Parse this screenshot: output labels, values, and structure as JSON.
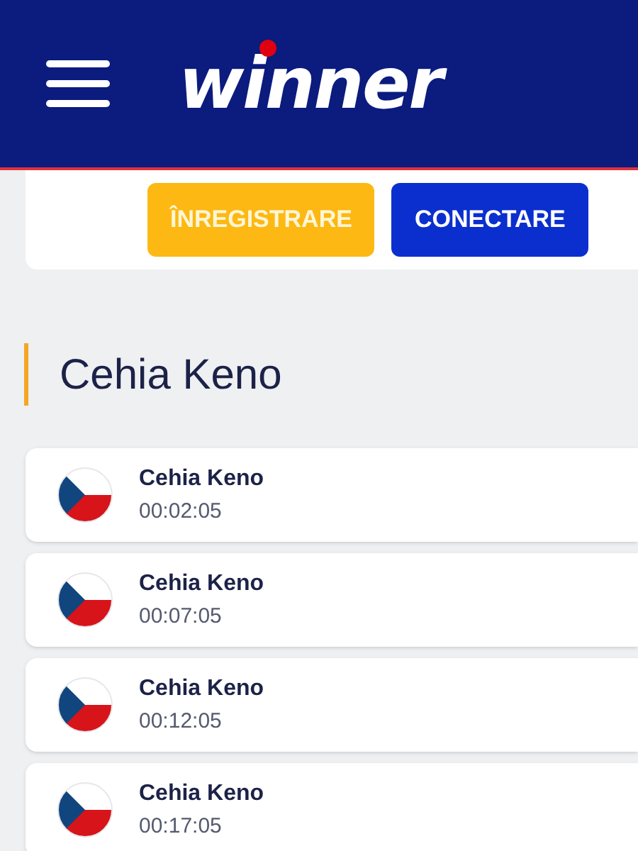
{
  "header": {
    "logo": "winner"
  },
  "auth_buttons": [
    {
      "label": "ÎNREGISTRARE",
      "kind": "register"
    },
    {
      "label": "CONECTARE",
      "kind": "login"
    }
  ],
  "section": {
    "title": "Cehia Keno"
  },
  "draws": [
    {
      "name": "Cehia Keno",
      "time": "00:02:05"
    },
    {
      "name": "Cehia Keno",
      "time": "00:07:05"
    },
    {
      "name": "Cehia Keno",
      "time": "00:12:05"
    },
    {
      "name": "Cehia Keno",
      "time": "00:17:05"
    }
  ]
}
